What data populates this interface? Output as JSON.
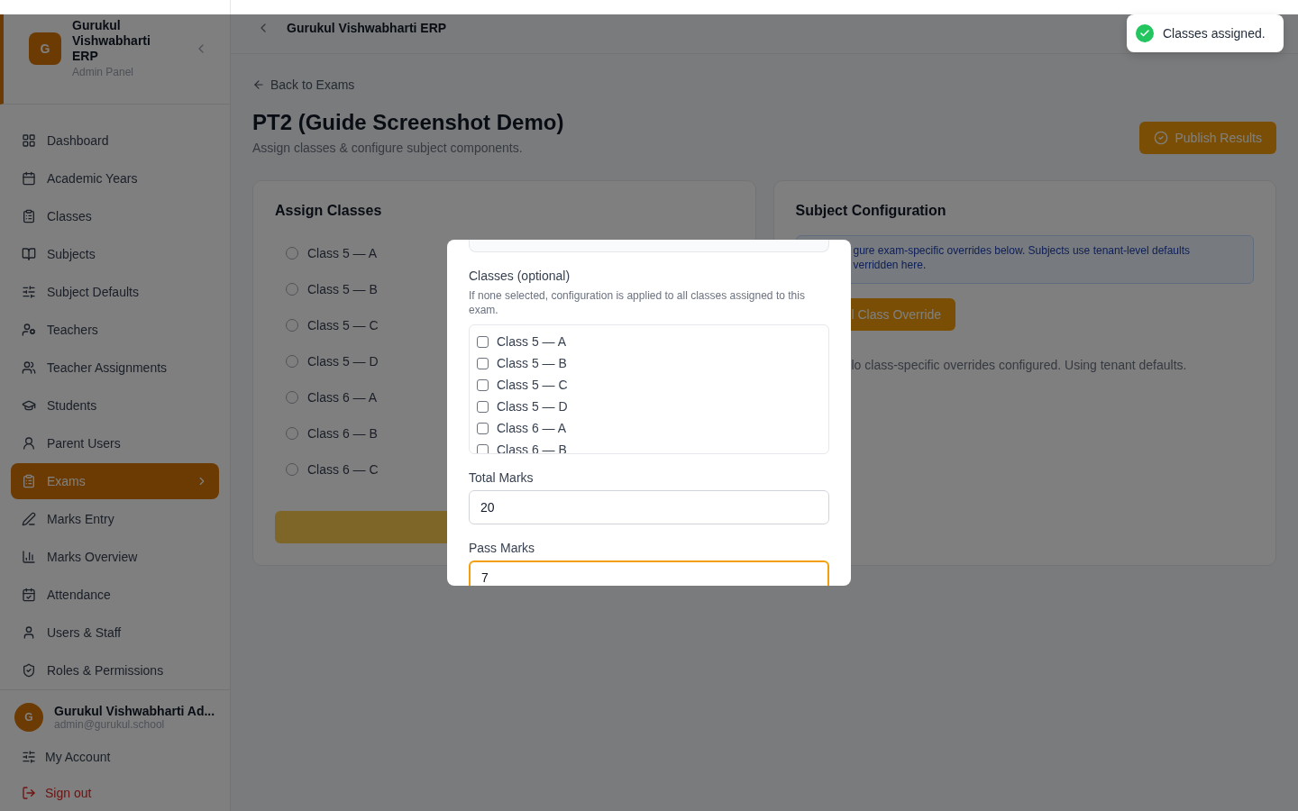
{
  "sidebar": {
    "brand": {
      "initial": "G",
      "name": "Gurukul Vishwabharti ERP",
      "subtitle": "Admin Panel"
    },
    "items": [
      {
        "label": "Dashboard",
        "selected": false
      },
      {
        "label": "Academic Years",
        "selected": false
      },
      {
        "label": "Classes",
        "selected": false
      },
      {
        "label": "Subjects",
        "selected": false
      },
      {
        "label": "Subject Defaults",
        "selected": false
      },
      {
        "label": "Teachers",
        "selected": false
      },
      {
        "label": "Teacher Assignments",
        "selected": false
      },
      {
        "label": "Students",
        "selected": false
      },
      {
        "label": "Parent Users",
        "selected": false
      },
      {
        "label": "Exams",
        "selected": true
      },
      {
        "label": "Marks Entry",
        "selected": false
      },
      {
        "label": "Marks Overview",
        "selected": false
      },
      {
        "label": "Attendance",
        "selected": false
      },
      {
        "label": "Users & Staff",
        "selected": false
      },
      {
        "label": "Roles & Permissions",
        "selected": false
      }
    ],
    "user": {
      "initial": "G",
      "name": "Gurukul Vishwabharti Ad...",
      "email": "admin@gurukul.school"
    },
    "footer_links": [
      {
        "label": "My Account",
        "kind": "account"
      },
      {
        "label": "Sign out",
        "kind": "signout"
      }
    ]
  },
  "topbar": {
    "title": "Gurukul Vishwabharti ERP"
  },
  "page": {
    "back_link": "Back to Exams",
    "title": "PT2 (Guide Screenshot Demo)",
    "subtitle": "Assign classes & configure subject components.",
    "publish_button": "Publish Results"
  },
  "assign_classes": {
    "title": "Assign Classes",
    "classes": [
      {
        "label": "Class 5 — A",
        "checked": false
      },
      {
        "label": "Class 5 — B",
        "checked": false
      },
      {
        "label": "Class 5 — C",
        "checked": false
      },
      {
        "label": "Class 5 — D",
        "checked": false
      },
      {
        "label": "Class 6 — A",
        "checked": false
      },
      {
        "label": "Class 6 — B",
        "checked": false
      },
      {
        "label": "Class 6 — C",
        "checked": false
      }
    ]
  },
  "subject_configuration": {
    "title": "Subject Configuration",
    "info_lines": [
      "gure exam-specific overrides below. Subjects use tenant-level defaults",
      "verridden here."
    ],
    "override_button": "l Class Override",
    "empty_text": "lo class-specific overrides configured. Using tenant defaults."
  },
  "modal": {
    "classes_label": "Classes (optional)",
    "classes_hint": "If none selected, configuration is applied to all classes assigned to this exam.",
    "classes": [
      {
        "label": "Class 5 — A",
        "checked": false
      },
      {
        "label": "Class 5 — B",
        "checked": false
      },
      {
        "label": "Class 5 — C",
        "checked": false
      },
      {
        "label": "Class 5 — D",
        "checked": false
      },
      {
        "label": "Class 6 — A",
        "checked": false
      },
      {
        "label": "Class 6 — B",
        "checked": false
      }
    ],
    "total_marks": {
      "label": "Total Marks",
      "value": "20"
    },
    "pass_marks": {
      "label": "Pass Marks",
      "value": "7",
      "focused": true
    }
  },
  "toast": {
    "message": "Classes assigned."
  }
}
